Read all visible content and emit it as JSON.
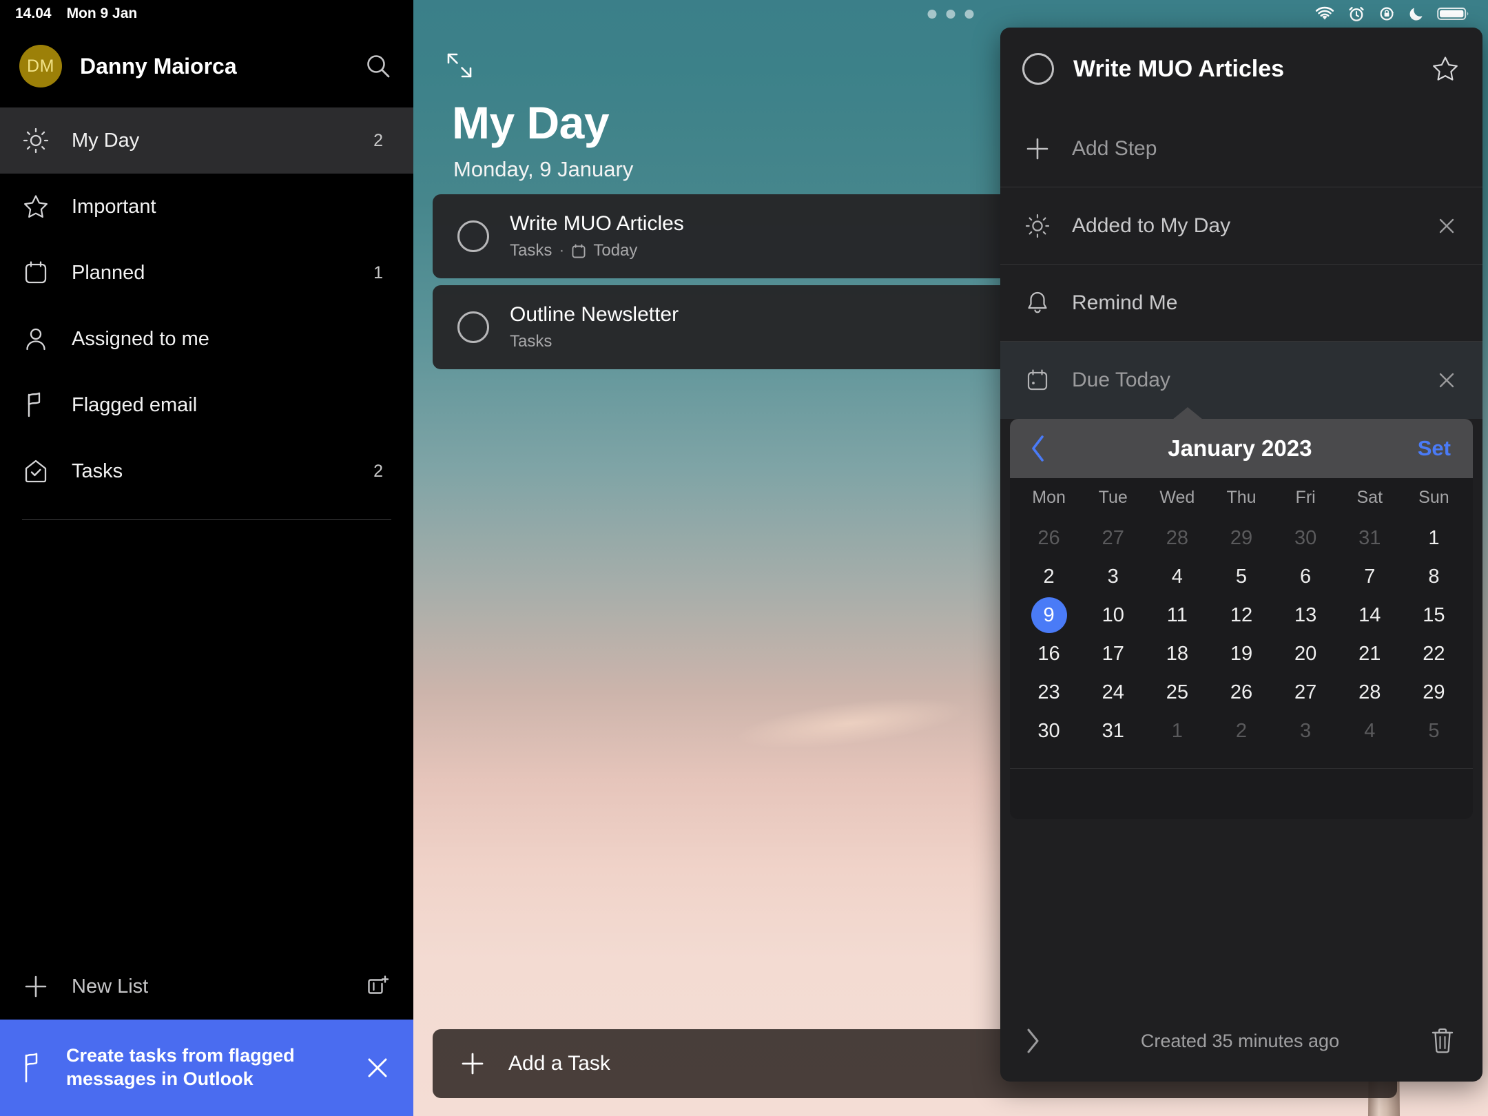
{
  "status_bar": {
    "time": "14.04",
    "date": "Mon 9 Jan",
    "icons": [
      "wifi-icon",
      "alarm-clock-icon",
      "rotation-lock-icon",
      "do-not-disturb-moon-icon",
      "battery-icon"
    ]
  },
  "sidebar": {
    "user": {
      "initials": "DM",
      "name": "Danny Maiorca"
    },
    "search_icon": "search-icon",
    "items": [
      {
        "label": "My Day",
        "count": "2",
        "icon": "sun-icon",
        "active": true
      },
      {
        "label": "Important",
        "count": "",
        "icon": "star-icon",
        "active": false
      },
      {
        "label": "Planned",
        "count": "1",
        "icon": "calendar-icon",
        "active": false
      },
      {
        "label": "Assigned to me",
        "count": "",
        "icon": "person-icon",
        "active": false
      },
      {
        "label": "Flagged email",
        "count": "",
        "icon": "flag-icon",
        "active": false
      },
      {
        "label": "Tasks",
        "count": "2",
        "icon": "house-check-icon",
        "active": false
      }
    ],
    "new_list": {
      "label": "New List",
      "plus_icon": "plus-icon",
      "new_group_icon": "new-list-group-icon"
    },
    "promo": {
      "line1": "Create tasks from flagged",
      "line2": "messages in Outlook",
      "icon": "flag-icon",
      "close_icon": "close-icon",
      "background": "#4a6cf0"
    }
  },
  "main": {
    "expand_icon": "expand-arrows-icon",
    "multitask_dots": "multitasking-dots",
    "title": "My Day",
    "subtitle": "Monday, 9 January",
    "tasks": [
      {
        "title": "Write MUO Articles",
        "list": "Tasks",
        "separator": "·",
        "due": "Today",
        "due_icon": "calendar-icon",
        "checkbox_icon": "circle-unchecked-icon"
      },
      {
        "title": "Outline Newsletter",
        "list": "Tasks",
        "separator": "",
        "due": "",
        "due_icon": "",
        "checkbox_icon": "circle-unchecked-icon"
      }
    ],
    "add_task": {
      "label": "Add a Task",
      "icon": "plus-icon"
    }
  },
  "detail_panel": {
    "checkbox_icon": "circle-unchecked-icon",
    "title": "Write MUO Articles",
    "star_icon": "star-outline-icon",
    "add_step": {
      "label": "Add Step",
      "icon": "plus-icon"
    },
    "rows": [
      {
        "label": "Added to My Day",
        "icon": "sun-icon",
        "has_close": true,
        "highlighted": false
      },
      {
        "label": "Remind Me",
        "icon": "bell-icon",
        "has_close": false,
        "highlighted": false
      },
      {
        "label": "Due Today",
        "icon": "calendar-icon",
        "has_close": true,
        "highlighted": true
      }
    ],
    "footer": {
      "chevron_icon": "chevron-right-icon",
      "created_text": "Created 35 minutes ago",
      "delete_icon": "trash-icon"
    }
  },
  "calendar": {
    "prev_icon": "chevron-left-icon",
    "month_label": "January 2023",
    "set_label": "Set",
    "accent": "#4a7bf7",
    "day_headers": [
      "Mon",
      "Tue",
      "Wed",
      "Thu",
      "Fri",
      "Sat",
      "Sun"
    ],
    "weeks": [
      [
        {
          "d": "26",
          "m": true
        },
        {
          "d": "27",
          "m": true
        },
        {
          "d": "28",
          "m": true
        },
        {
          "d": "29",
          "m": true
        },
        {
          "d": "30",
          "m": true
        },
        {
          "d": "31",
          "m": true
        },
        {
          "d": "1",
          "m": false
        }
      ],
      [
        {
          "d": "2",
          "m": false
        },
        {
          "d": "3",
          "m": false
        },
        {
          "d": "4",
          "m": false
        },
        {
          "d": "5",
          "m": false
        },
        {
          "d": "6",
          "m": false
        },
        {
          "d": "7",
          "m": false
        },
        {
          "d": "8",
          "m": false
        }
      ],
      [
        {
          "d": "9",
          "m": false,
          "sel": true
        },
        {
          "d": "10",
          "m": false
        },
        {
          "d": "11",
          "m": false
        },
        {
          "d": "12",
          "m": false
        },
        {
          "d": "13",
          "m": false
        },
        {
          "d": "14",
          "m": false
        },
        {
          "d": "15",
          "m": false
        }
      ],
      [
        {
          "d": "16",
          "m": false
        },
        {
          "d": "17",
          "m": false
        },
        {
          "d": "18",
          "m": false
        },
        {
          "d": "19",
          "m": false
        },
        {
          "d": "20",
          "m": false
        },
        {
          "d": "21",
          "m": false
        },
        {
          "d": "22",
          "m": false
        }
      ],
      [
        {
          "d": "23",
          "m": false
        },
        {
          "d": "24",
          "m": false
        },
        {
          "d": "25",
          "m": false
        },
        {
          "d": "26",
          "m": false
        },
        {
          "d": "27",
          "m": false
        },
        {
          "d": "28",
          "m": false
        },
        {
          "d": "29",
          "m": false
        }
      ],
      [
        {
          "d": "30",
          "m": false
        },
        {
          "d": "31",
          "m": false
        },
        {
          "d": "1",
          "m": true
        },
        {
          "d": "2",
          "m": true
        },
        {
          "d": "3",
          "m": true
        },
        {
          "d": "4",
          "m": true
        },
        {
          "d": "5",
          "m": true
        }
      ]
    ],
    "selected_day": "9"
  },
  "theme": {
    "sidebar_bg": "#000000",
    "panel_bg": "#1f1f21",
    "accent_blue": "#4a7bf7",
    "promo_blue": "#4a6cf0",
    "avatar_gold": "#9c8008",
    "photo_top": "#3b7f89",
    "photo_bottom": "#f4ddd5"
  }
}
